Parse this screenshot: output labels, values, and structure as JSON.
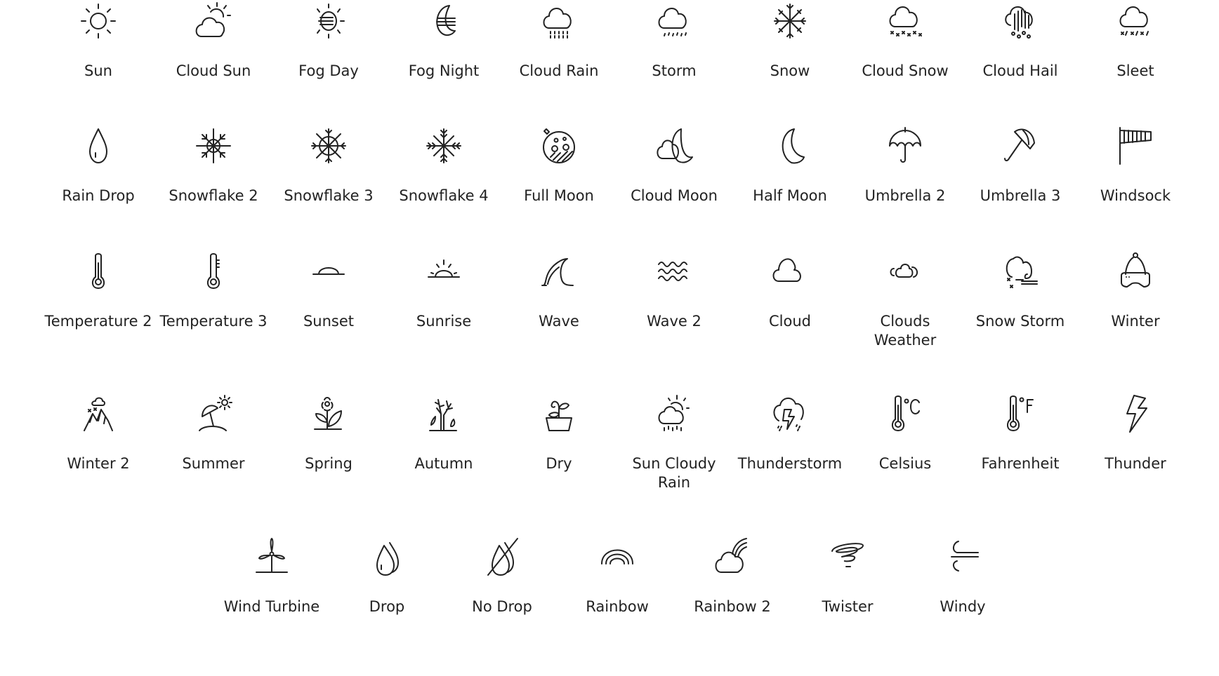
{
  "icons": [
    {
      "label": "Sun",
      "icon": "sun-icon"
    },
    {
      "label": "Cloud Sun",
      "icon": "cloud-sun-icon"
    },
    {
      "label": "Fog Day",
      "icon": "fog-day-icon"
    },
    {
      "label": "Fog Night",
      "icon": "fog-night-icon"
    },
    {
      "label": "Cloud Rain",
      "icon": "cloud-rain-icon"
    },
    {
      "label": "Storm",
      "icon": "storm-icon"
    },
    {
      "label": "Snow",
      "icon": "snow-icon"
    },
    {
      "label": "Cloud Snow",
      "icon": "cloud-snow-icon"
    },
    {
      "label": "Cloud Hail",
      "icon": "cloud-hail-icon"
    },
    {
      "label": "Sleet",
      "icon": "sleet-icon"
    },
    {
      "label": "Rain Drop",
      "icon": "rain-drop-icon"
    },
    {
      "label": "Snowflake 2",
      "icon": "snowflake-2-icon"
    },
    {
      "label": "Snowflake 3",
      "icon": "snowflake-3-icon"
    },
    {
      "label": "Snowflake 4",
      "icon": "snowflake-4-icon"
    },
    {
      "label": "Full Moon",
      "icon": "full-moon-icon"
    },
    {
      "label": "Cloud Moon",
      "icon": "cloud-moon-icon"
    },
    {
      "label": "Half Moon",
      "icon": "half-moon-icon"
    },
    {
      "label": "Umbrella 2",
      "icon": "umbrella-2-icon"
    },
    {
      "label": "Umbrella 3",
      "icon": "umbrella-3-icon"
    },
    {
      "label": "Windsock",
      "icon": "windsock-icon"
    },
    {
      "label": "Temperature 2",
      "icon": "temperature-2-icon"
    },
    {
      "label": "Temperature 3",
      "icon": "temperature-3-icon"
    },
    {
      "label": "Sunset",
      "icon": "sunset-icon"
    },
    {
      "label": "Sunrise",
      "icon": "sunrise-icon"
    },
    {
      "label": "Wave",
      "icon": "wave-icon"
    },
    {
      "label": "Wave 2",
      "icon": "wave-2-icon"
    },
    {
      "label": "Cloud",
      "icon": "cloud-icon"
    },
    {
      "label": "Clouds Weather",
      "icon": "clouds-weather-icon"
    },
    {
      "label": "Snow Storm",
      "icon": "snow-storm-icon"
    },
    {
      "label": "Winter",
      "icon": "winter-icon"
    },
    {
      "label": "Winter 2",
      "icon": "winter-2-icon"
    },
    {
      "label": "Summer",
      "icon": "summer-icon"
    },
    {
      "label": "Spring",
      "icon": "spring-icon"
    },
    {
      "label": "Autumn",
      "icon": "autumn-icon"
    },
    {
      "label": "Dry",
      "icon": "dry-icon"
    },
    {
      "label": "Sun Cloudy Rain",
      "icon": "sun-cloudy-rain-icon"
    },
    {
      "label": "Thunderstorm",
      "icon": "thunderstorm-icon"
    },
    {
      "label": "Celsius",
      "icon": "celsius-icon"
    },
    {
      "label": "Fahrenheit",
      "icon": "fahrenheit-icon"
    },
    {
      "label": "Thunder",
      "icon": "thunder-icon"
    },
    {
      "label": "Wind Turbine",
      "icon": "wind-turbine-icon"
    },
    {
      "label": "Drop",
      "icon": "drop-icon"
    },
    {
      "label": "No Drop",
      "icon": "no-drop-icon"
    },
    {
      "label": "Rainbow",
      "icon": "rainbow-icon"
    },
    {
      "label": "Rainbow 2",
      "icon": "rainbow-2-icon"
    },
    {
      "label": "Twister",
      "icon": "twister-icon"
    },
    {
      "label": "Windy",
      "icon": "windy-icon"
    }
  ],
  "colors": {
    "icon_stroke": "#222222",
    "text": "#222222",
    "background": "#ffffff"
  }
}
